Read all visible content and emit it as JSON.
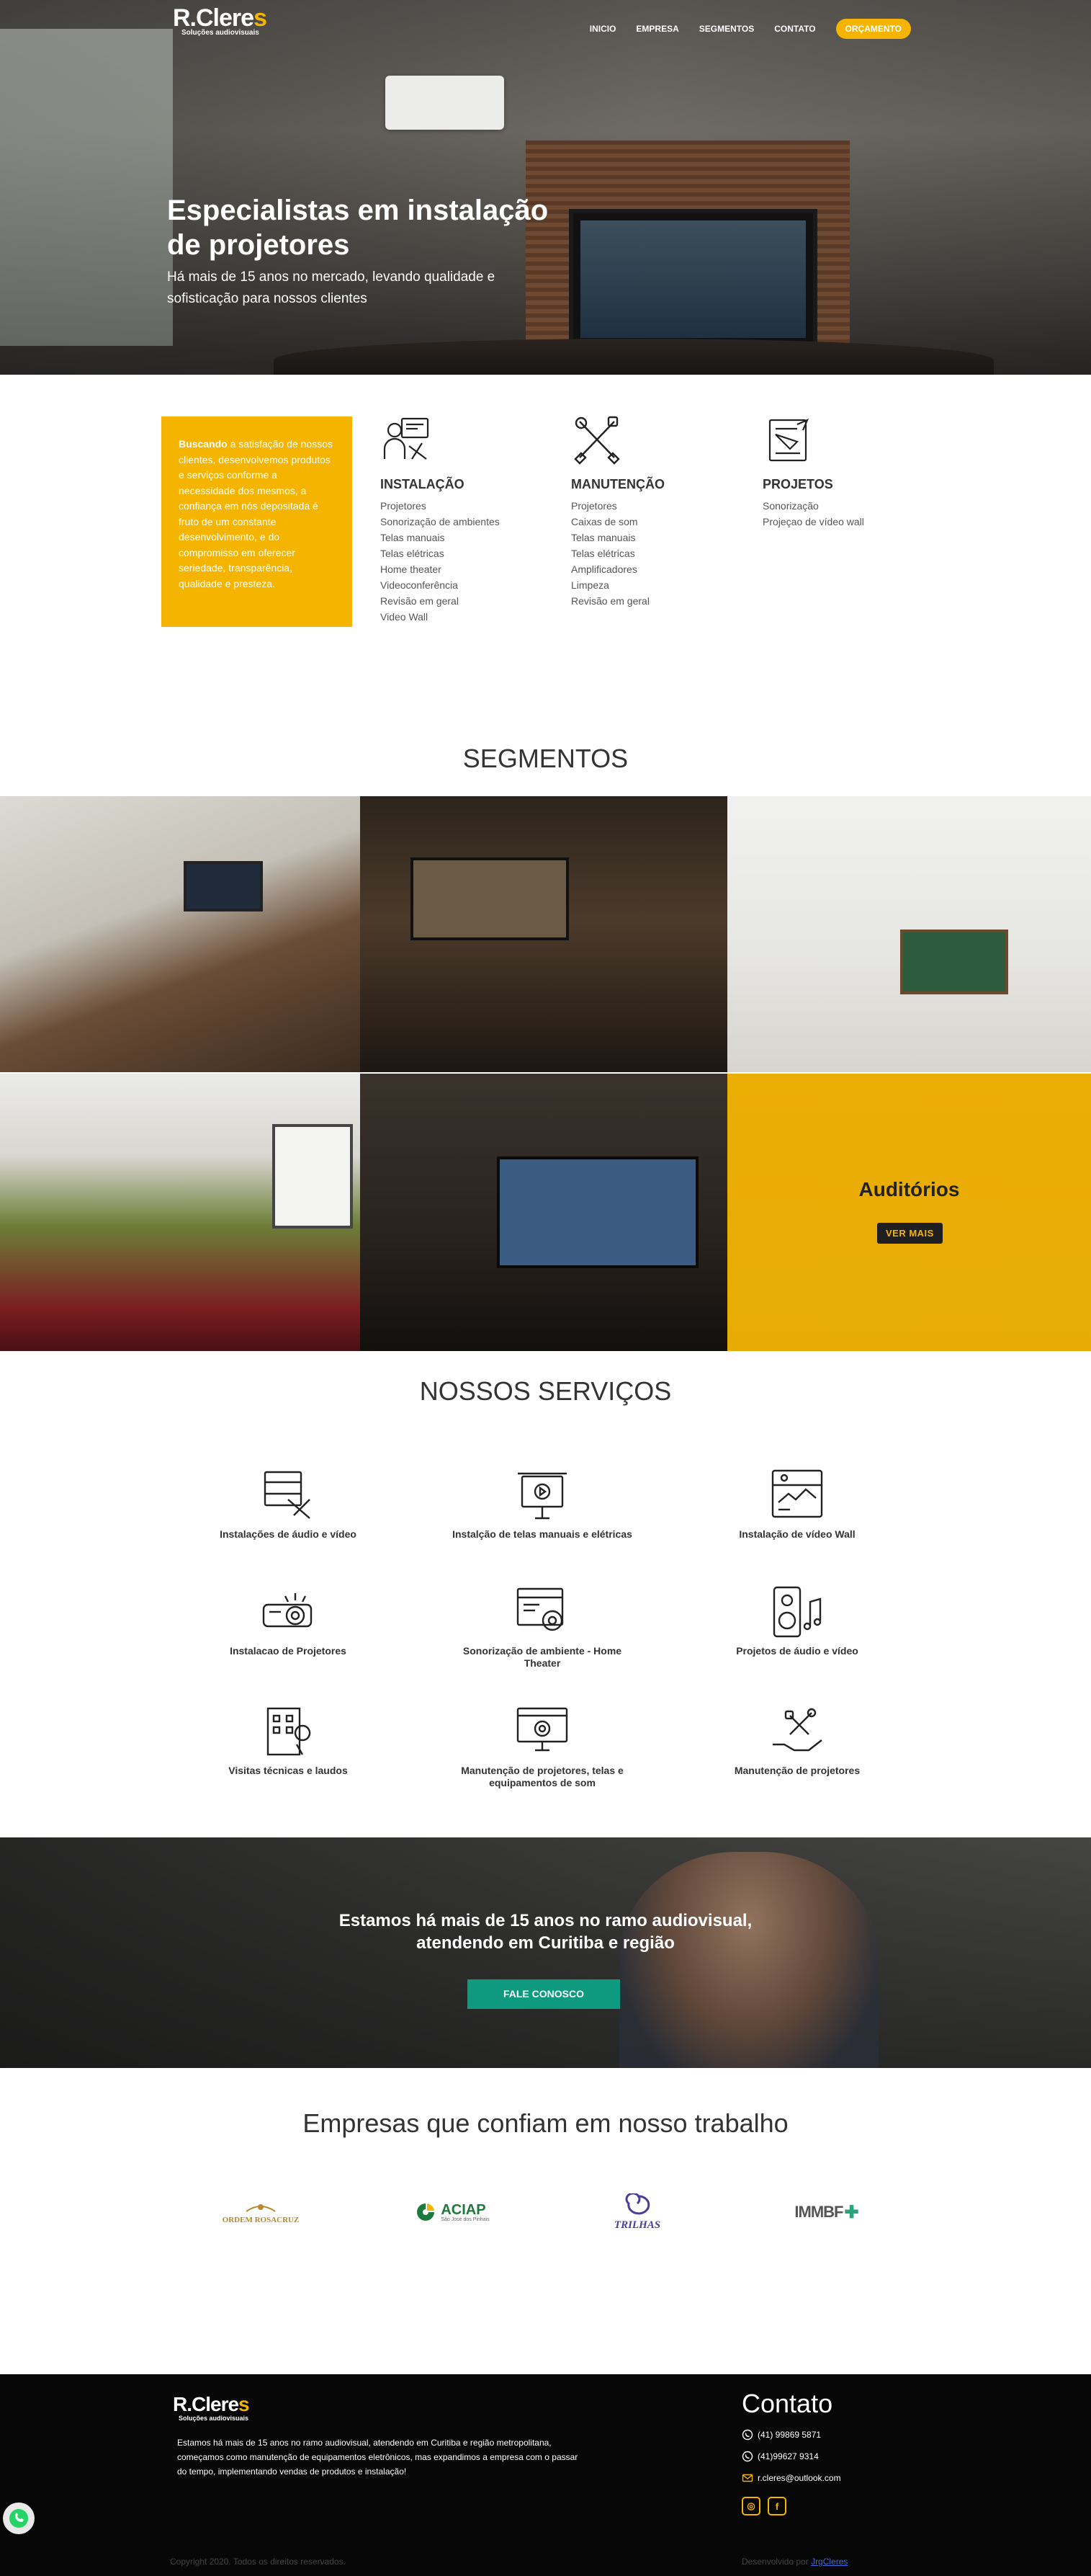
{
  "brand": {
    "name_main": "R.Clere",
    "name_accent": "s",
    "tagline": "Soluções audiovisuais"
  },
  "nav": {
    "items": [
      "INICIO",
      "EMPRESA",
      "SEGMENTOS",
      "CONTATO"
    ],
    "cta": "ORÇAMENTO"
  },
  "hero": {
    "title_line1": "Especialistas em instalação",
    "title_line2": "de projetores",
    "subtitle_line1": "Há mais de 15 anos no mercado, levando qualidade e",
    "subtitle_line2": "sofisticação para nossos clientes"
  },
  "intro": {
    "highlight": "Buscando",
    "text": "a satisfação de nossos clientes, desenvolvemos produtos e serviços conforme a necessidade dos mesmos, a confiança em nós depositada é fruto de um constante desenvolvimento, e do compromisso em oferecer seriedade, transparência, qualidade e presteza."
  },
  "columns": [
    {
      "title": "INSTALAÇÃO",
      "icon": "installer-icon",
      "items": [
        "Projetores",
        "Sonorização de ambientes",
        "Telas manuais",
        "Telas elétricas",
        "Home theater",
        "Videoconferência",
        "Revisão em geral",
        "Video Wall"
      ]
    },
    {
      "title": "MANUTENÇÃO",
      "icon": "tools-icon",
      "items": [
        "Projetores",
        "Caixas de som",
        "Telas manuais",
        "Telas elétricas",
        "Amplificadores",
        "Limpeza",
        "Revisão em geral"
      ]
    },
    {
      "title": "PROJETOS",
      "icon": "blueprint-icon",
      "items": [
        "Sonorização",
        "Projeçao de vídeo wall"
      ]
    }
  ],
  "segments": {
    "title": "SEGMENTOS",
    "featured_label": "Auditórios",
    "button": "VER MAIS"
  },
  "services": {
    "title": "NOSSOS SERVIÇOS",
    "items": [
      {
        "label": "Instalações de áudio e vídeo",
        "icon": "audio-video-install-icon"
      },
      {
        "label": "Instalção de telas manuais e elétricas",
        "icon": "projection-screen-icon"
      },
      {
        "label": "Instalação de vídeo Wall",
        "icon": "video-wall-icon"
      },
      {
        "label": "Instalacao de Projetores",
        "icon": "projector-icon"
      },
      {
        "label": "Sonorização de ambiente - Home Theater",
        "icon": "home-theater-icon"
      },
      {
        "label": "Projetos de áudio e vídeo",
        "icon": "speaker-icon"
      },
      {
        "label": "Visitas técnicas e laudos",
        "icon": "building-location-icon"
      },
      {
        "label": "Manutenção de projetores, telas e equipamentos de som",
        "icon": "monitor-gear-icon"
      },
      {
        "label": "Manutenção de projetores",
        "icon": "hand-tools-icon"
      }
    ]
  },
  "banner": {
    "line1": "Estamos há mais de 15 anos no ramo audiovisual,",
    "line2": "atendendo em Curitiba e região",
    "button": "FALE CONOSCO"
  },
  "partners": {
    "title": "Empresas que confiam em nosso trabalho",
    "logos": [
      {
        "name": "ORDEM ROSACRUZ",
        "color": "#b8892c"
      },
      {
        "name": "ACIAP",
        "sub": "São José dos Pinhais",
        "color": "#1e7a3a"
      },
      {
        "name": "TRILHAS",
        "color": "#4a3e9a"
      },
      {
        "name": "IMMBF",
        "color": "#2aa37a"
      }
    ]
  },
  "footer": {
    "about": "Estamos há mais de 15 anos no ramo audiovisual, atendendo em Curitiba e região metropolitana, começamos como manutenção de equipamentos eletrônicos, mas expandimos a empresa com o passar do tempo, implementando vendas de produtos e instalação!",
    "contact_title": "Contato",
    "phone1": "(41) 99869 5871",
    "phone2": "(41)99627 9314",
    "email": "r.cleres@outlook.com",
    "copyright": "Copyright 2020. Todos os direitos reservados.",
    "developed_by": "Desenvolvido por",
    "developer": "JrgCleres"
  },
  "colors": {
    "accent": "#f5b400",
    "cta_green": "#0d9a7e",
    "footer_bg": "#070707"
  }
}
